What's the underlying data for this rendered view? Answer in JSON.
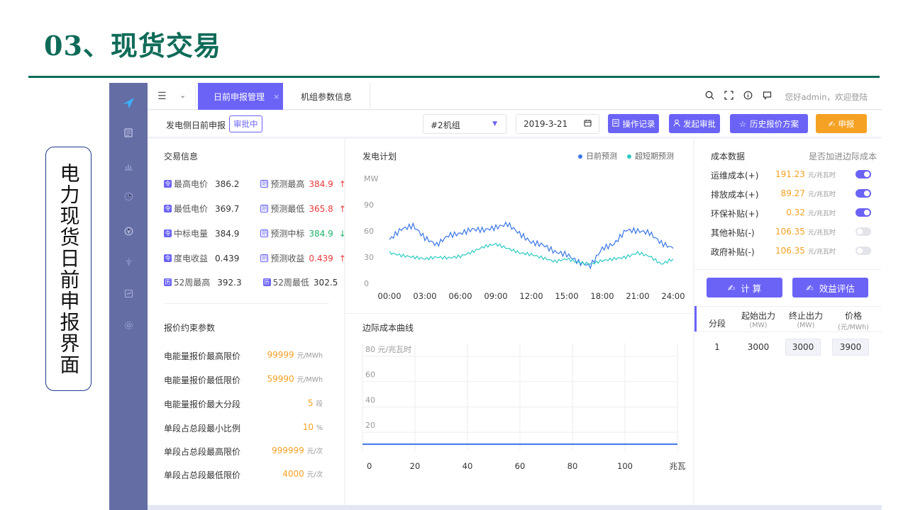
{
  "slide": {
    "title": "03、现货交易",
    "side_label": "电力现货日前申报界面"
  },
  "sidebar": {
    "icons": [
      "logo-icon",
      "document-icon",
      "bar-chart-icon",
      "clock-icon",
      "yen-icon",
      "tower-icon",
      "check-icon",
      "gear-icon"
    ]
  },
  "topbar": {
    "menu_glyph": "☰",
    "caret": "⌄",
    "tabs": [
      {
        "label": "日前申报管理",
        "close": "×"
      },
      {
        "label": "机组参数信息"
      }
    ],
    "icons": [
      "search-icon",
      "fullscreen-icon",
      "info-icon",
      "message-icon"
    ],
    "greeting": "您好admin，欢迎登陆"
  },
  "toolbar": {
    "label": "发电侧日前申报",
    "status_badge": "审批中",
    "unit_select": "#2机组",
    "date": "2019-3-21",
    "buttons": {
      "log": "操作记录",
      "approve": "发起审批",
      "history": "历史报价方案",
      "submit": "申报"
    },
    "colors": {
      "accent": "#6b63f6",
      "submit": "#f5a123"
    }
  },
  "trade_info": {
    "title": "交易信息",
    "rows": [
      {
        "name": "最高电价",
        "value": "386.2",
        "pred_name": "预测最高",
        "pred_value": "384.9",
        "trend": "↑",
        "trend_dir": "up"
      },
      {
        "name": "最低电价",
        "value": "369.7",
        "pred_name": "预测最低",
        "pred_value": "365.8",
        "trend": "↑",
        "trend_dir": "up"
      },
      {
        "name": "中标电量",
        "value": "384.9",
        "pred_name": "预测中标",
        "pred_value": "384.9",
        "trend": "↓",
        "trend_dir": "down"
      },
      {
        "name": "度电收益",
        "value": "0.439",
        "pred_name": "预测收益",
        "pred_value": "0.439",
        "trend": "↑",
        "trend_dir": "up"
      }
    ],
    "week": {
      "high_label": "52周最高",
      "high_value": "392.3",
      "low_label": "52周最低",
      "low_value": "302.5"
    }
  },
  "price_constraints": {
    "title": "报价约束参数",
    "rows": [
      {
        "label": "电能量报价最高限价",
        "value": "99999",
        "unit": "元/MWh"
      },
      {
        "label": "电能量报价最低限价",
        "value": "59990",
        "unit": "元/MWh"
      },
      {
        "label": "电能量报价最大分段",
        "value": "5",
        "unit": "段"
      },
      {
        "label": "单段占总段最小比例",
        "value": "10",
        "unit": "%"
      },
      {
        "label": "单段占总段最高限价",
        "value": "999999",
        "unit": "元/次"
      },
      {
        "label": "单段占总段最低限价",
        "value": "4000",
        "unit": "元/次"
      }
    ]
  },
  "gen_plan": {
    "title": "发电计划",
    "legend": [
      {
        "name": "日前预测",
        "color": "#3a76e6"
      },
      {
        "name": "超短期预测",
        "color": "#2ec9c2"
      }
    ]
  },
  "marginal_cost": {
    "title": "边际成本曲线"
  },
  "cost_data": {
    "title": "成本数据",
    "subtitle": "是否加进边际成本",
    "rows": [
      {
        "label": "运维成本(+)",
        "value": "191.23",
        "unit": "元/兆瓦时",
        "enabled": true
      },
      {
        "label": "排放成本(+)",
        "value": "89.27",
        "unit": "元/兆瓦时",
        "enabled": true
      },
      {
        "label": "环保补贴(+)",
        "value": "0.32",
        "unit": "元/兆瓦时",
        "enabled": true
      },
      {
        "label": "其他补贴(-)",
        "value": "106.35",
        "unit": "元/兆瓦时",
        "enabled": false
      },
      {
        "label": "政府补贴(-)",
        "value": "106.35",
        "unit": "元/兆瓦时",
        "enabled": false
      }
    ],
    "buttons": {
      "calc": "计 算",
      "evaluate": "效益评估"
    }
  },
  "segment_table": {
    "headers": [
      {
        "label": "分段",
        "unit": ""
      },
      {
        "label": "起始出力",
        "unit": "(MW)"
      },
      {
        "label": "终止出力",
        "unit": "(MW)"
      },
      {
        "label": "价格",
        "unit": "(元/MWh)"
      }
    ],
    "rows": [
      {
        "seg": "1",
        "start": "3000",
        "end": "3000",
        "price": "3900"
      }
    ]
  },
  "chart_data": [
    {
      "type": "line",
      "title": "发电计划",
      "ylabel": "MW",
      "ylim": [
        0,
        120
      ],
      "yticks": [
        "MW",
        "90",
        "60",
        "30",
        "0"
      ],
      "xticks": [
        "00:00",
        "03:00",
        "06:00",
        "09:00",
        "12:00",
        "15:00",
        "18:00",
        "21:00",
        "24:00"
      ],
      "grid": false,
      "legend_position": "top-right",
      "series": [
        {
          "name": "日前预测",
          "color": "#3a76e6",
          "x": [
            0,
            1,
            2,
            3,
            4,
            5,
            6,
            7,
            8,
            9,
            10,
            11,
            12,
            13,
            14,
            15,
            16,
            17,
            18,
            19,
            20,
            21,
            22,
            23,
            24
          ],
          "values": [
            50,
            62,
            66,
            52,
            44,
            55,
            57,
            62,
            61,
            64,
            68,
            57,
            47,
            44,
            36,
            33,
            24,
            20,
            40,
            45,
            61,
            60,
            58,
            46,
            40
          ]
        },
        {
          "name": "超短期预测",
          "color": "#2ec9c2",
          "x": [
            0,
            1,
            2,
            3,
            4,
            5,
            6,
            7,
            8,
            9,
            10,
            11,
            12,
            13,
            14,
            15,
            16,
            17,
            18,
            19,
            20,
            21,
            22,
            23,
            24
          ],
          "values": [
            35,
            32,
            30,
            28,
            30,
            29,
            31,
            36,
            42,
            45,
            40,
            35,
            33,
            29,
            25,
            28,
            24,
            22,
            26,
            28,
            30,
            35,
            31,
            22,
            28
          ]
        }
      ]
    },
    {
      "type": "line",
      "title": "边际成本曲线",
      "ylabel": "元/兆瓦时",
      "xlabel": "兆瓦",
      "yticks": [
        "80 元/兆瓦时",
        "60",
        "40",
        "20"
      ],
      "xticks": [
        "0",
        "20",
        "40",
        "60",
        "80",
        "100",
        "兆瓦"
      ],
      "ylim": [
        0,
        85
      ],
      "xlim": [
        0,
        120
      ],
      "grid": true,
      "series": [
        {
          "color": "#3a76e6",
          "x": [
            0,
            120
          ],
          "values": [
            5,
            5
          ]
        }
      ]
    }
  ]
}
